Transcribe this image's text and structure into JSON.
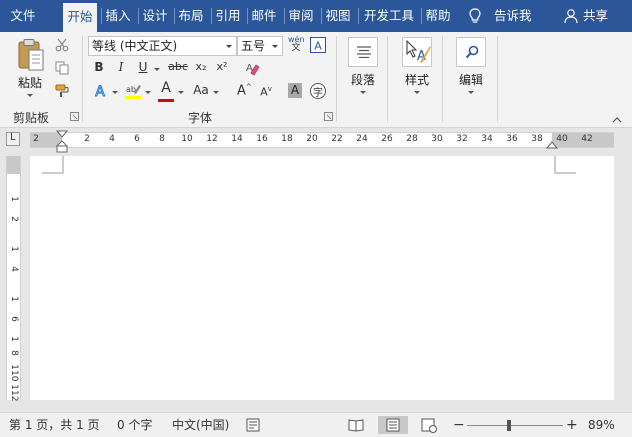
{
  "menubar": {
    "tabs": [
      "文件",
      "开始",
      "插入",
      "设计",
      "布局",
      "引用",
      "邮件",
      "审阅",
      "视图",
      "开发工具",
      "帮助"
    ],
    "active_tab": "开始",
    "tell_me": "告诉我",
    "share": "共享",
    "bg_color": "#2b579a"
  },
  "ribbon": {
    "clipboard": {
      "paste_label": "粘贴",
      "group_label": "剪贴板",
      "icons": [
        "paste-icon",
        "cut-icon",
        "copy-icon",
        "format-painter-icon"
      ]
    },
    "font": {
      "font_name": "等线 (中文正文)",
      "font_size": "五号",
      "group_label": "字体",
      "bold": "B",
      "italic": "I",
      "underline": "U",
      "strikethrough": "abc",
      "subscript": "x₂",
      "superscript": "x²",
      "font_color_letter": "A",
      "change_case": "Aa",
      "grow": "A",
      "shrink": "A",
      "char_shading": "A",
      "enclosed_char": "字",
      "phonetic_top": "wén",
      "phonetic_bottom": "文",
      "highlight_color": "#ffff00",
      "font_color": "#e00000"
    },
    "paragraph": {
      "label": "段落"
    },
    "styles": {
      "label": "样式"
    },
    "editing": {
      "label": "编辑"
    }
  },
  "ruler": {
    "corner": "L",
    "h_numbers": [
      "2",
      "2",
      "4",
      "6",
      "8",
      "10",
      "12",
      "14",
      "16",
      "18",
      "20",
      "22",
      "24",
      "26",
      "28",
      "30",
      "32",
      "34",
      "36",
      "38",
      "40",
      "42"
    ],
    "v_numbers": [
      "1",
      "2",
      "1",
      "4",
      "1",
      "6",
      "1",
      "8",
      "1",
      "10",
      "1",
      "12"
    ]
  },
  "statusbar": {
    "page": "第 1 页，共 1 页",
    "words": "0 个字",
    "language": "中文(中国)",
    "zoom": "89%",
    "zoom_minus": "−",
    "zoom_plus": "+"
  }
}
